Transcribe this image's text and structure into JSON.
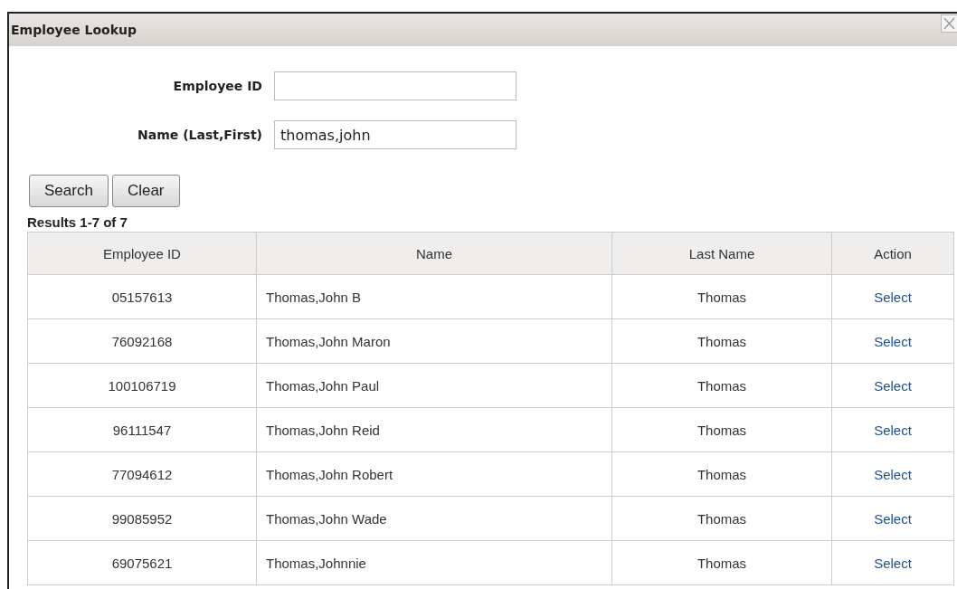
{
  "window": {
    "title": "Employee Lookup"
  },
  "form": {
    "fields": [
      {
        "label": "Employee ID"
      },
      {
        "label": "Name (Last,First)",
        "value": "thomas,john"
      }
    ],
    "buttons": [
      "Search",
      "Clear"
    ]
  },
  "results": {
    "summary": "Results 1-7 of 7"
  },
  "table": {
    "columns": [
      "Employee ID",
      "Name",
      "Last Name",
      "Action"
    ],
    "rows": [
      {
        "id": "05157613",
        "name": "Thomas,John B",
        "last_name": "Thomas",
        "action": "Select"
      },
      {
        "id": "76092168",
        "name": "Thomas,John Maron",
        "last_name": "Thomas",
        "action": "Select"
      },
      {
        "id": "100106719",
        "name": "Thomas,John Paul",
        "last_name": "Thomas",
        "action": "Select"
      },
      {
        "id": "96111547",
        "name": "Thomas,John Reid",
        "last_name": "Thomas",
        "action": "Select"
      },
      {
        "id": "77094612",
        "name": "Thomas,John Robert",
        "last_name": "Thomas",
        "action": "Select"
      },
      {
        "id": "99085952",
        "name": "Thomas,John Wade",
        "last_name": "Thomas",
        "action": "Select"
      },
      {
        "id": "69075621",
        "name": "Thomas,Johnnie",
        "last_name": "Thomas",
        "action": "Select"
      }
    ]
  }
}
